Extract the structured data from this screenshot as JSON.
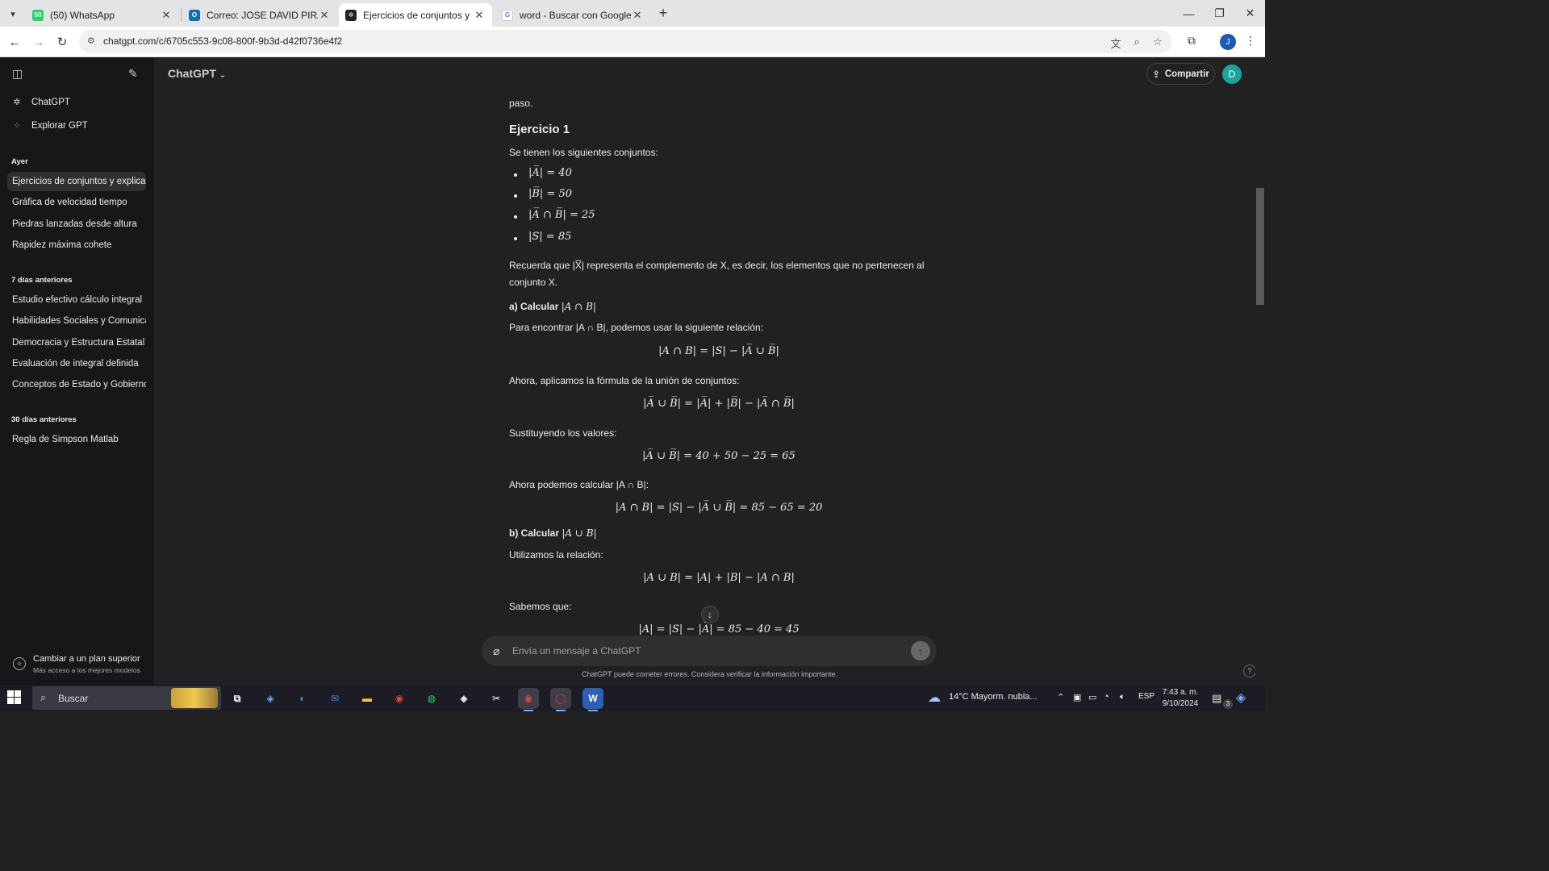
{
  "browser": {
    "tabs": [
      {
        "title": "(50) WhatsApp",
        "icon": "whatsapp-icon",
        "color": "#25d366"
      },
      {
        "title": "Correo: JOSE DAVID PIRA RODRÍ",
        "icon": "outlook-icon",
        "color": "#0f6cbd"
      },
      {
        "title": "Ejercicios de conjuntos y explic",
        "icon": "chatgpt-icon",
        "color": "#222222"
      },
      {
        "title": "word - Buscar con Google",
        "icon": "google-icon",
        "color": "#4285f4"
      }
    ],
    "url": "chatgpt.com/c/6705c553-9c08-800f-9b3d-d42f0736e4f2",
    "profile_initial": "J"
  },
  "sidebar": {
    "nav": [
      {
        "label": "ChatGPT",
        "icon": "openai-icon"
      },
      {
        "label": "Explorar GPT",
        "icon": "grid-icon"
      }
    ],
    "sections": [
      {
        "title": "Ayer",
        "items": [
          "Ejercicios de conjuntos y explica",
          "Gráfica de velocidad tiempo",
          "Piedras lanzadas desde altura",
          "Rapidez máxima cohete"
        ]
      },
      {
        "title": "7 días anteriores",
        "items": [
          "Estudio efectivo cálculo integral",
          "Habilidades Sociales y Comunicación",
          "Democracia y Estructura Estatal",
          "Evaluación de integral definida",
          "Conceptos de Estado y Gobierno"
        ]
      },
      {
        "title": "30 días anteriores",
        "items": [
          "Regla de Simpson Matlab"
        ]
      }
    ],
    "upgrade": {
      "title": "Cambiar a un plan superior",
      "subtitle": "Más acceso a los mejores modelos"
    }
  },
  "header": {
    "model": "ChatGPT",
    "share_label": "Compartir",
    "avatar_initial": "D"
  },
  "message": {
    "lead": "paso.",
    "heading": "Ejercicio 1",
    "intro": "Se tienen los siguientes conjuntos:",
    "bullets": [
      "|A̅| = 40",
      "|B̅| = 50",
      "|A̅ ∩ B̅| = 25",
      "|S| = 85"
    ],
    "note_1": "Recuerda que |X̅| representa el complemento de X, es decir, los elementos que no pertenecen al",
    "note_2": "conjunto X.",
    "part_a_label": "a) Calcular",
    "part_a_math": "|A ∩ B|",
    "part_a_text": "Para encontrar |A ∩ B|, podemos usar la siguiente relación:",
    "eq1": "|A ∩ B| = |S| − |A̅ ∪ B̅|",
    "union_text": "Ahora, aplicamos la fórmula de la unión de conjuntos:",
    "eq2": "|A̅ ∪ B̅| = |A̅| + |B̅| − |A̅ ∩ B̅|",
    "subst_text": "Sustituyendo los valores:",
    "eq3": "|A̅ ∪ B̅| = 40 + 50 − 25 = 65",
    "calc_text": "Ahora podemos calcular |A ∩ B|:",
    "eq4": "|A ∩ B| = |S| − |A̅ ∪ B̅| = 85 − 65 = 20",
    "part_b_label": "b) Calcular",
    "part_b_math": "|A ∪ B|",
    "rel_text": "Utilizamos la relación:",
    "eq5": "|A ∪ B| = |A| + |B| − |A ∩ B|",
    "known_text": "Sabemos que:",
    "eq6": "|A| = |S| − |A̅| = 85 − 40 = 45"
  },
  "composer": {
    "placeholder": "Envía un mensaje a ChatGPT"
  },
  "disclaimer": "ChatGPT puede cometer errores. Considera verificar la información importante.",
  "taskbar": {
    "search_label": "Buscar",
    "weather": "14°C  Mayorm. nubla...",
    "lang": "ESP",
    "time": "7:43 a. m.",
    "date": "9/10/2024",
    "notif_count": "3"
  }
}
